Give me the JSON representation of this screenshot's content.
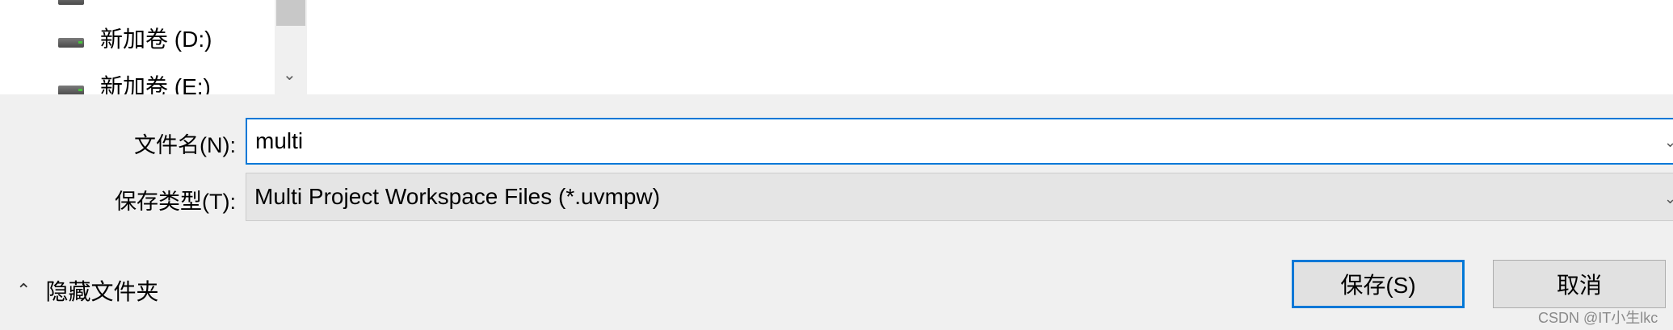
{
  "tree": {
    "items": [
      {
        "label": "新加卷 (D:)",
        "icon": "drive-icon"
      },
      {
        "label": "新加卷 (E:)",
        "icon": "drive-icon"
      }
    ]
  },
  "form": {
    "filename_label": "文件名(N):",
    "filename_value": "multi",
    "type_label": "保存类型(T):",
    "type_value": "Multi Project Workspace Files (*.uvmpw)"
  },
  "footer": {
    "hide_folders_label": "隐藏文件夹",
    "save_label": "保存(S)",
    "cancel_label": "取消"
  },
  "watermark": "CSDN @IT小生lkc",
  "colors": {
    "accent": "#0078d7",
    "dialog_bg": "#f0f0f0"
  }
}
